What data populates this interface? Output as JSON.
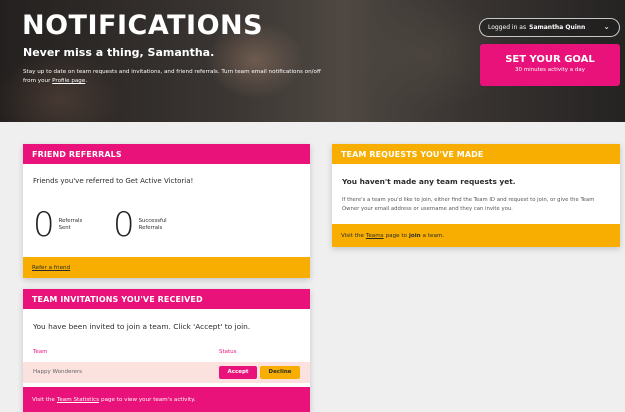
{
  "hero": {
    "title": "NOTIFICATIONS",
    "subtitle": "Never miss a thing, Samantha.",
    "desc_text": "Stay up to date on team requests and invitations, and friend referrals. Turn team email notifications on/off from your",
    "desc_link": "Profile page",
    "desc_end": "."
  },
  "account": {
    "logged_in_label": "Logged in as",
    "user_name": "Samantha Quinn",
    "chevron": "chevron-down-icon"
  },
  "goal": {
    "title": "SET YOUR GOAL",
    "subtitle": "30 minutes activity a day"
  },
  "referrals": {
    "header": "FRIEND REFERRALS",
    "intro": "Friends you've referred to Get Active Victoria!",
    "sent_count": "0",
    "sent_label": "Referrals Sent",
    "success_count": "0",
    "success_label": "Successful Referrals",
    "footer_link": "Refer a friend"
  },
  "invitations": {
    "header": "TEAM INVITATIONS YOU'VE RECEIVED",
    "intro": "You have been invited to join a team. Click 'Accept' to join.",
    "columns": [
      "Team",
      "Status"
    ],
    "rows": [
      {
        "team": "Happy Wonderers",
        "accept": "Accept",
        "decline": "Decline"
      }
    ],
    "footer_pre": "Visit the",
    "footer_link": "Team Statistics",
    "footer_post": "page to view your team's activity."
  },
  "requests": {
    "header": "TEAM REQUESTS YOU'VE MADE",
    "title": "You haven't made any team requests yet.",
    "desc": "If there's a team you'd like to join, either find the Team ID and request to join, or give the Team Owner your email address or username and they can invite you.",
    "footer_pre": "Visit the",
    "footer_link": "Teams",
    "footer_mid": "page to",
    "footer_bold": "join",
    "footer_post": "a team."
  },
  "colors": {
    "brand_pink": "#e8127a",
    "brand_amber": "#f7ae00"
  }
}
